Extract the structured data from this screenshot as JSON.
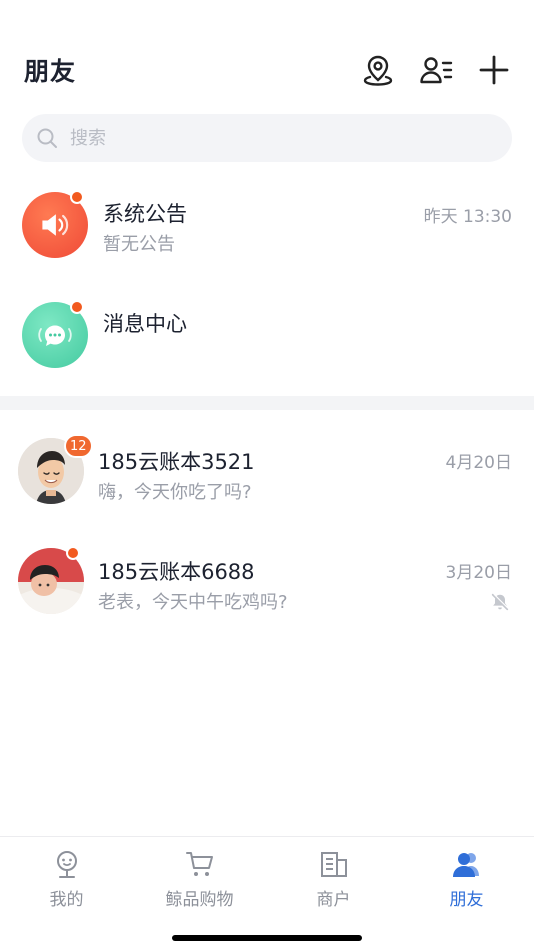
{
  "header": {
    "title": "朋友",
    "icons": [
      "location-pin-icon",
      "contact-list-icon",
      "plus-icon"
    ]
  },
  "search": {
    "placeholder": "搜索",
    "value": ""
  },
  "system_rows": [
    {
      "title": "系统公告",
      "subtitle": "暂无公告",
      "time": "昨天 13:30",
      "icon": "speaker-icon",
      "color": "#f4603b",
      "unread_dot": true
    },
    {
      "title": "消息中心",
      "subtitle": "",
      "time": "",
      "icon": "chat-bubble-icon",
      "color": "#4fd1a5",
      "unread_dot": true
    }
  ],
  "chats": [
    {
      "name": "185云账本3521",
      "preview": "嗨，今天你吃了吗?",
      "time": "4月20日",
      "unread_count": "12",
      "muted": false
    },
    {
      "name": "185云账本6688",
      "preview": "老表，今天中午吃鸡吗?",
      "time": "3月20日",
      "unread_dot": true,
      "muted": true
    }
  ],
  "tabs": [
    {
      "label": "我的",
      "icon": "profile-icon",
      "active": false
    },
    {
      "label": "鲸品购物",
      "icon": "cart-icon",
      "active": false
    },
    {
      "label": "商户",
      "icon": "merchant-icon",
      "active": false
    },
    {
      "label": "朋友",
      "icon": "friends-icon",
      "active": true
    }
  ],
  "colors": {
    "accent": "#2f6ed8",
    "badge": "#f25a1f",
    "muted_text": "#9a9ea8"
  }
}
